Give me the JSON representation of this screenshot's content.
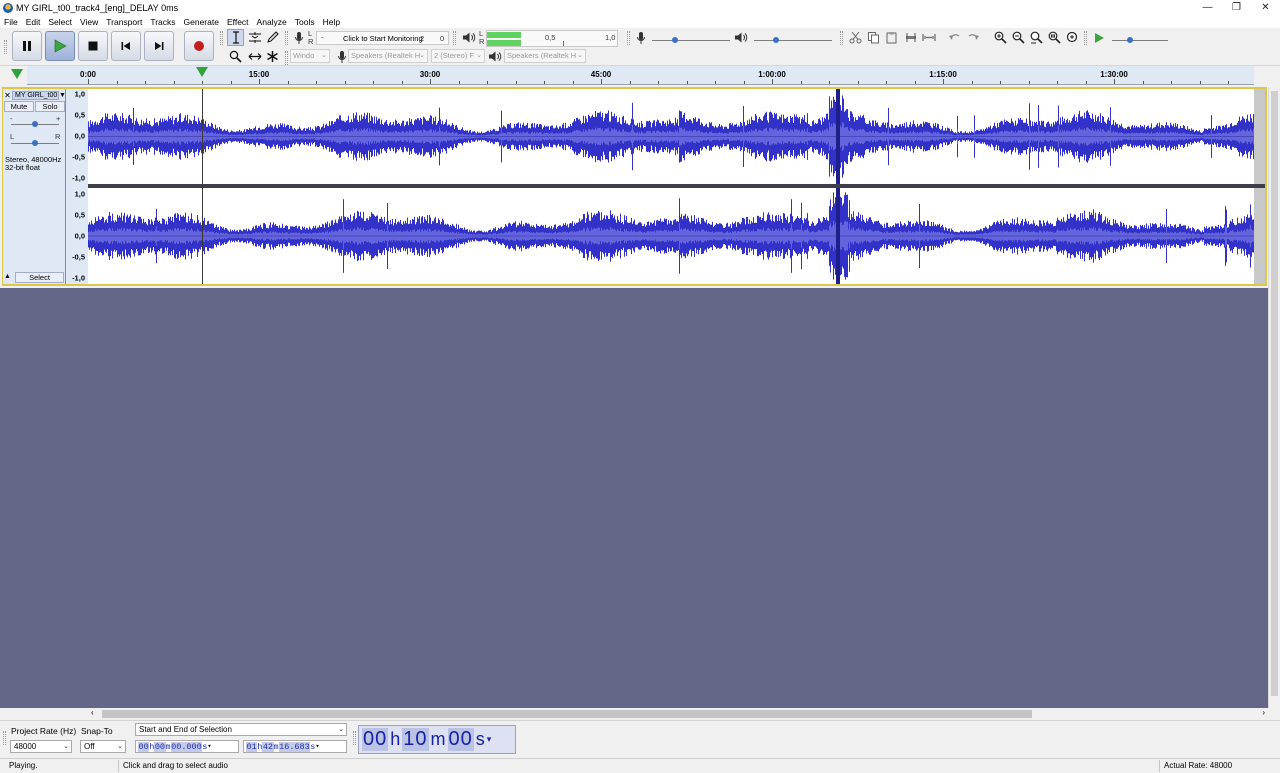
{
  "window": {
    "title": "MY GIRL_t00_track4_[eng]_DELAY 0ms"
  },
  "menu": [
    "File",
    "Edit",
    "Select",
    "View",
    "Transport",
    "Tracks",
    "Generate",
    "Effect",
    "Analyze",
    "Tools",
    "Help"
  ],
  "meter": {
    "record_hint": "Click to Start Monitoring",
    "record_ticks": [
      "-",
      "2",
      "0"
    ],
    "playback_ticks": [
      "0,5",
      "1,0"
    ],
    "lr": [
      "L",
      "R"
    ]
  },
  "devices": {
    "host": "Windo",
    "input": "Speakers (Realtek H",
    "channels": "2 (Stereo) F",
    "output": "Speakers (Realtek H"
  },
  "ruler": {
    "labels": [
      {
        "text": "0:00",
        "seconds": 0
      },
      {
        "text": "15:00",
        "seconds": 900
      },
      {
        "text": "30:00",
        "seconds": 1800
      },
      {
        "text": "45:00",
        "seconds": 2700
      },
      {
        "text": "1:00:00",
        "seconds": 3600
      },
      {
        "text": "1:15:00",
        "seconds": 4500
      },
      {
        "text": "1:30:00",
        "seconds": 5400
      }
    ],
    "playhead_seconds": 600
  },
  "track": {
    "name": "MY GIRL_t00",
    "mute": "Mute",
    "solo": "Solo",
    "gain_minus": "-",
    "gain_plus": "+",
    "pan_left": "L",
    "pan_right": "R",
    "info_line1": "Stereo, 48000Hz",
    "info_line2": "32-bit float",
    "select": "Select",
    "scale": [
      "1,0",
      "0,5",
      "0,0",
      "-0,5",
      "-1,0"
    ]
  },
  "selection": {
    "project_rate_label": "Project Rate (Hz)",
    "project_rate_value": "48000",
    "snap_to_label": "Snap-To",
    "snap_to_value": "Off",
    "mode": "Start and End of Selection",
    "start": {
      "h": "00",
      "m": "00",
      "s": "00.000"
    },
    "end": {
      "h": "01",
      "m": "42",
      "s": "16.683"
    },
    "units": {
      "h": "h",
      "m": "m",
      "s": "s"
    }
  },
  "audio_position": {
    "h": "00",
    "m": "10",
    "s": "00"
  },
  "status": {
    "state": "Playing.",
    "hint": "Click and drag to select audio",
    "actual_rate": "Actual Rate: 48000"
  },
  "colors": {
    "waveform": "#3232c8",
    "waveform_rms": "#6464dc",
    "track_bg": "#dfe9f6",
    "empty_bg": "#646687",
    "selected_border": "#d9c84a"
  }
}
